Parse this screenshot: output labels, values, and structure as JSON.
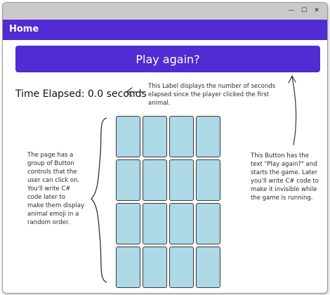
{
  "window": {
    "controls": {
      "minimize": "—",
      "maximize": "☐",
      "close": "✕"
    }
  },
  "navbar": {
    "title": "Home"
  },
  "main": {
    "play_again_label": "Play again?",
    "time_label": "Time Elapsed: 0.0 seconds",
    "grid": {
      "rows": 4,
      "columns": 4,
      "button_color": "#add8e6"
    }
  },
  "annotations": {
    "label_note": "This Label displays the number of seconds\nelapsed since the player clicked the first animal.",
    "grid_note": "The page has a\ngroup of Button\ncontrols that the\nuser can click on.\nYou'll write C#\ncode later to\nmake them display\nanimal emoji in a\nrandom order.",
    "button_note": "This Button has the\ntext \"Play again?\" and\nstarts the game. Later\nyou'll write C# code to\nmake it invisible while\nthe game is running."
  },
  "colors": {
    "accent": "#512bd4",
    "titlebar": "#c9c9c9"
  }
}
